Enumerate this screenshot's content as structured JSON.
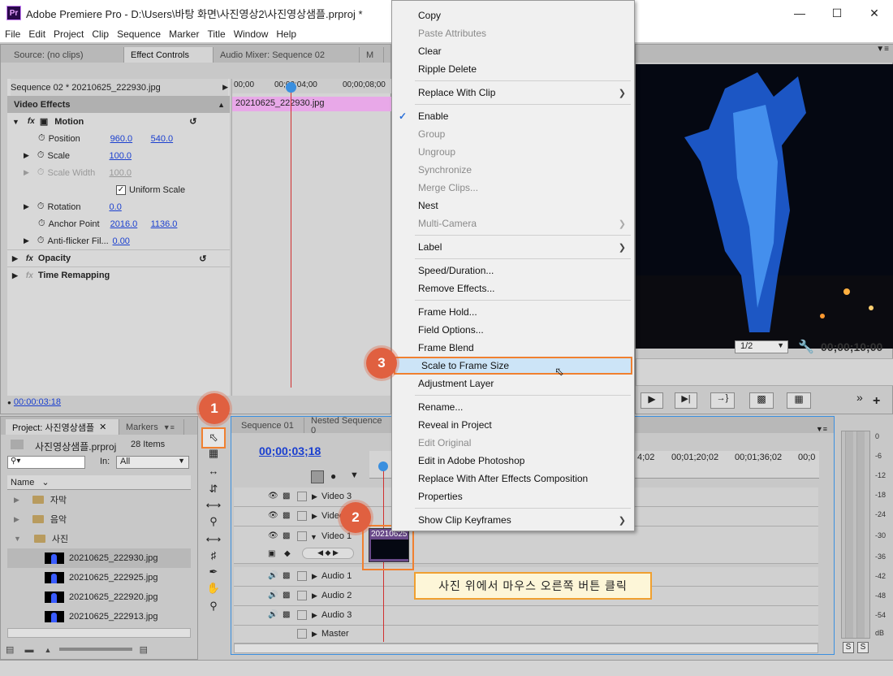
{
  "window": {
    "title": "Adobe Premiere Pro - D:\\Users\\바탕 화면\\사진영상2\\사진영상샘플.prproj *",
    "logo_text": "Pr",
    "minimize_icon": "minimize-icon",
    "maximize_icon": "maximize-icon",
    "close_icon": "close-icon"
  },
  "menu": [
    "File",
    "Edit",
    "Project",
    "Clip",
    "Sequence",
    "Marker",
    "Title",
    "Window",
    "Help"
  ],
  "top_tabs": {
    "source": "Source: (no clips)",
    "effect_controls": "Effect Controls",
    "audio_mixer": "Audio Mixer: Sequence 02",
    "more": "M"
  },
  "effect_controls": {
    "sequence_label": "Sequence 02 * 20210625_222930.jpg",
    "timecodes": [
      "00;00",
      "00;00;04;00",
      "00;00;08;00"
    ],
    "clip_name": "20210625_222930.jpg",
    "section": "Video Effects",
    "motion": "Motion",
    "position_label": "Position",
    "position_x": "960.0",
    "position_y": "540.0",
    "scale_label": "Scale",
    "scale_value": "100.0",
    "scale_width_label": "Scale Width",
    "scale_width_value": "100.0",
    "uniform_scale": "Uniform Scale",
    "rotation_label": "Rotation",
    "rotation_value": "0.0",
    "anchor_label": "Anchor Point",
    "anchor_x": "2016.0",
    "anchor_y": "1136.0",
    "antiflicker_label": "Anti-flicker Fil...",
    "antiflicker_value": "0.00",
    "opacity": "Opacity",
    "time_remapping": "Time Remapping",
    "footer_timecode": "00:00:03:18"
  },
  "context_menu": [
    {
      "label": "Copy",
      "disabled": false,
      "arrow": false
    },
    {
      "label": "Paste Attributes",
      "disabled": true,
      "arrow": false
    },
    {
      "label": "Clear",
      "disabled": false,
      "arrow": false
    },
    {
      "label": "Ripple Delete",
      "disabled": false,
      "arrow": false
    },
    {
      "label": "Replace With Clip",
      "disabled": false,
      "arrow": true
    },
    {
      "label": "Enable",
      "disabled": false,
      "arrow": false,
      "checked": true
    },
    {
      "label": "Group",
      "disabled": true,
      "arrow": false
    },
    {
      "label": "Ungroup",
      "disabled": true,
      "arrow": false
    },
    {
      "label": "Synchronize",
      "disabled": true,
      "arrow": false
    },
    {
      "label": "Merge Clips...",
      "disabled": true,
      "arrow": false
    },
    {
      "label": "Nest",
      "disabled": false,
      "arrow": false
    },
    {
      "label": "Multi-Camera",
      "disabled": true,
      "arrow": true
    },
    {
      "label": "Label",
      "disabled": false,
      "arrow": true
    },
    {
      "label": "Speed/Duration...",
      "disabled": false,
      "arrow": false
    },
    {
      "label": "Remove Effects...",
      "disabled": false,
      "arrow": false
    },
    {
      "label": "Frame Hold...",
      "disabled": false,
      "arrow": false
    },
    {
      "label": "Field Options...",
      "disabled": false,
      "arrow": false
    },
    {
      "label": "Frame Blend",
      "disabled": false,
      "arrow": false
    },
    {
      "label": "Scale to Frame Size",
      "disabled": false,
      "arrow": false,
      "highlighted": true
    },
    {
      "label": "Adjustment Layer",
      "disabled": false,
      "arrow": false
    },
    {
      "label": "Rename...",
      "disabled": false,
      "arrow": false
    },
    {
      "label": "Reveal in Project",
      "disabled": false,
      "arrow": false
    },
    {
      "label": "Edit Original",
      "disabled": true,
      "arrow": false
    },
    {
      "label": "Edit in Adobe Photoshop",
      "disabled": false,
      "arrow": false
    },
    {
      "label": "Replace With After Effects Composition",
      "disabled": false,
      "arrow": false
    },
    {
      "label": "Properties",
      "disabled": false,
      "arrow": false
    },
    {
      "label": "Show Clip Keyframes",
      "disabled": false,
      "arrow": true
    }
  ],
  "program_monitor": {
    "zoom": "1/2",
    "timecode": "00;00;10;00"
  },
  "project": {
    "tab_label": "Project: 사진영상샘플",
    "markers_tab": "Markers",
    "file_name": "사진영상샘플.prproj",
    "item_count": "28 Items",
    "in_label": "In:",
    "in_value": "All",
    "name_header": "Name",
    "folders": [
      "자막",
      "음악",
      "사진"
    ],
    "files": [
      "20210625_222930.jpg",
      "20210625_222925.jpg",
      "20210625_222920.jpg",
      "20210625_222913.jpg"
    ]
  },
  "timeline": {
    "tabs": [
      "Sequence 01",
      "Nested Sequence 0"
    ],
    "timecode": "00;00;03;18",
    "ruler": [
      "4;02",
      "00;01;20;02",
      "00;01;36;02",
      "00;0"
    ],
    "tracks": [
      "Video 3",
      "Video",
      "Video 1",
      "Audio 1",
      "Audio 2",
      "Audio 3",
      "Master"
    ],
    "clip_label": "20210625"
  },
  "callout_text": "사진 위에서 마우스 오른쪽 버튼 클릭",
  "badges": [
    "1",
    "2",
    "3"
  ],
  "meter_scale": [
    "0",
    "-6",
    "-12",
    "-18",
    "-24",
    "-30",
    "-36",
    "-42",
    "-48",
    "-54",
    "dB"
  ],
  "meter_solo": [
    "S",
    "S"
  ]
}
